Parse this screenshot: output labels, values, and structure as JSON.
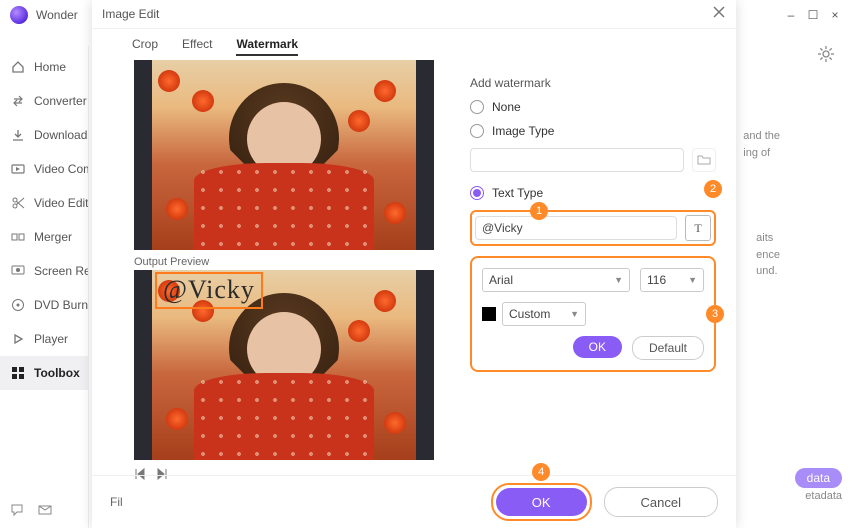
{
  "brand": "Wonder",
  "window": {
    "close": "×",
    "min": "–",
    "max": "☐"
  },
  "sidebar": {
    "items": [
      {
        "label": "Home",
        "icon": "home-icon"
      },
      {
        "label": "Converter",
        "icon": "converter-icon"
      },
      {
        "label": "Download",
        "icon": "download-icon"
      },
      {
        "label": "Video Compressor",
        "icon": "video-compress-icon"
      },
      {
        "label": "Video Editor",
        "icon": "scissors-icon"
      },
      {
        "label": "Merger",
        "icon": "merger-icon"
      },
      {
        "label": "Screen Recorder",
        "icon": "screen-rec-icon"
      },
      {
        "label": "DVD Burner",
        "icon": "dvd-icon"
      },
      {
        "label": "Player",
        "icon": "player-icon"
      },
      {
        "label": "Toolbox",
        "icon": "toolbox-icon"
      }
    ]
  },
  "bg": {
    "line1": "and the",
    "line2": "ing of",
    "line3": "aits",
    "line4": "ence",
    "line5": "und."
  },
  "modal": {
    "title": "Image Edit",
    "tabs": {
      "crop": "Crop",
      "effect": "Effect",
      "watermark": "Watermark"
    },
    "output_label": "Output Preview",
    "watermark_text": "@Vicky",
    "add_label": "Add watermark",
    "opt_none": "None",
    "opt_img": "Image Type",
    "opt_text": "Text Type",
    "text_value": "@Vicky",
    "font": "Arial",
    "size": "116",
    "color_mode": "Custom",
    "panel_ok": "OK",
    "panel_default": "Default",
    "markers": {
      "m1": "1",
      "m2": "2",
      "m3": "3",
      "m4": "4"
    },
    "footer": {
      "fil": "Fil",
      "ok": "OK",
      "cancel": "Cancel"
    },
    "pill": "data",
    "pill2": "etadata"
  }
}
